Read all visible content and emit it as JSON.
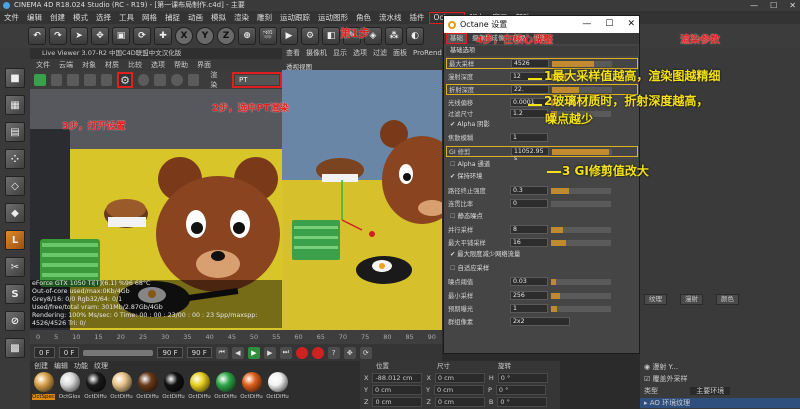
{
  "window": {
    "title": "CINEMA 4D R18.024 Studio (RC - R19) - [第一课布局制作.c4d] - 主要",
    "min": "—",
    "max": "☐",
    "close": "✕"
  },
  "menubar": [
    "文件",
    "编辑",
    "创建",
    "模式",
    "选择",
    "工具",
    "网格",
    "捕捉",
    "动画",
    "模拟",
    "渲染",
    "雕刻",
    "运动跟踪",
    "运动图形",
    "角色",
    "流水线",
    "插件",
    "Octane",
    "脚本",
    "窗口",
    "帮助"
  ],
  "toolbar": {
    "icons": [
      "arrow-icon",
      "move-icon",
      "scale-icon",
      "rotate-icon",
      "x-axis",
      "y-axis",
      "z-axis",
      "coord-icon",
      "film-icon",
      "render-icon",
      "render-settings-icon",
      "cube-icon",
      "pen-icon",
      "subdiv-icon",
      "array-icon",
      "deformer-icon",
      "floor-icon",
      "camera-icon",
      "light-icon"
    ],
    "xyz": [
      "X",
      "Y",
      "Z"
    ]
  },
  "live_viewer": {
    "title": "Live Viewer 3.07-R2 中国C4D联盟中文汉化版",
    "menu": [
      "文件",
      "云端",
      "对象",
      "材质",
      "比较",
      "选项",
      "帮助",
      "界面"
    ],
    "mode_label": "渲染",
    "mode_value": "PT"
  },
  "viewport": {
    "menu": [
      "查看",
      "摄像机",
      "显示",
      "选项",
      "过滤",
      "面板",
      "ProRender"
    ],
    "label": "透视视图"
  },
  "stats": [
    "eForce GTX 1050 Ti[T](6.1) %96      68°C",
    "Out-of-core used/max:0Kb/4Gb",
    "Grey8/16: 0/0        Rgb32/64: 0/1",
    "Used/free/total vram: 301Mb/2.87Gb/4Gb",
    "Rendering: 100%   Ms/sec: 0   Time: 00 : 00 : 23/00 : 00 : 23   Spp/maxspp: 4526/4526   Tri: 0/"
  ],
  "timeline": {
    "ticks": [
      "0",
      "5",
      "10",
      "15",
      "20",
      "25",
      "30",
      "35",
      "40",
      "45",
      "50",
      "55",
      "60",
      "65",
      "70",
      "75",
      "80",
      "85",
      "90"
    ],
    "start": "0 F",
    "end": "90 F",
    "current": "0 F",
    "max": "90 F"
  },
  "materials": {
    "menu": [
      "创建",
      "编辑",
      "功能",
      "纹理"
    ],
    "items": [
      {
        "label": "OctSpec",
        "color": "#d9a24a",
        "selected": true
      },
      {
        "label": "OctGlos",
        "color": "#d9d9d9",
        "selected": false
      },
      {
        "label": "OctDiffu",
        "color": "#1a1a1a",
        "selected": false
      },
      {
        "label": "OctDiffu",
        "color": "#e8c48a",
        "selected": false
      },
      {
        "label": "OctDiffu",
        "color": "#6a3a1a",
        "selected": false
      },
      {
        "label": "OctDiffu",
        "color": "#111111",
        "selected": false
      },
      {
        "label": "OctDiffu",
        "color": "#e8d020",
        "selected": false
      },
      {
        "label": "OctDiffu",
        "color": "#2fa84a",
        "selected": false
      },
      {
        "label": "OctDiffu",
        "color": "#e0601a",
        "selected": false
      },
      {
        "label": "OctDiffu",
        "color": "#f2f2f2",
        "selected": false
      }
    ]
  },
  "coords": {
    "headers": [
      "位置",
      "尺寸",
      "旋转"
    ],
    "rows": [
      {
        "axis": "X",
        "pos": "-88.012 cm",
        "size_axis": "X",
        "size": "0 cm",
        "rot_axis": "H",
        "rot": "0 °"
      },
      {
        "axis": "Y",
        "pos": "0 cm",
        "size_axis": "Y",
        "size": "0 cm",
        "rot_axis": "P",
        "rot": "0 °"
      },
      {
        "axis": "Z",
        "pos": "0 cm",
        "size_axis": "Z",
        "size": "0 cm",
        "rot_axis": "B",
        "rot": "0 °"
      }
    ]
  },
  "right_panel": {
    "btn1": "纹理",
    "btn2": "漫射",
    "btn3": "颜色",
    "row1": "◉ 漫射 Y...",
    "row2": "☑ 覆盖外采样",
    "row3": "类型",
    "row3_value": "主要环境",
    "row4": "▸ AO 环境纹理"
  },
  "dialog": {
    "title": "Octane 设置",
    "tabs": [
      "基础",
      "摄像机成像",
      "后期",
      "设置"
    ],
    "section_kernel": "基础选项",
    "params": [
      {
        "label": "最大采样",
        "value": "4526",
        "fill": 0.7,
        "highlight": true
      },
      {
        "label": "漫射深度",
        "value": "12",
        "fill": 0.25,
        "highlight": false
      },
      {
        "label": "折射深度",
        "value": "22.",
        "fill": 0.45,
        "highlight": true
      },
      {
        "label": "光线偏移",
        "value": "0.0001",
        "fill": 0.05,
        "highlight": false
      },
      {
        "label": "过滤尺寸",
        "value": "1.2",
        "fill": 0.1,
        "highlight": false
      }
    ],
    "alpha_shadows": "Alpha 阴影",
    "caustic_label": "焦散模糊",
    "caustic_value": "1",
    "gi_label": "GI 修剪",
    "gi_value": "11052.95 s",
    "alpha_channel": "Alpha 通道",
    "keep_env": "保持环境",
    "path_term_label": "路径终止强度",
    "path_term_value": "0.3",
    "coherent_label": "连贯比率",
    "coherent_value": "0",
    "static_noise": "静态噪点",
    "parallel_label": "并行采样",
    "parallel_value": "8",
    "max_tile_label": "最大平铺采样",
    "max_tile_value": "16",
    "min_net": "最大限度减少网络流量",
    "adaptive": "自适应采样",
    "noise_thr_label": "噪点阈值",
    "noise_thr_value": "0.03",
    "min_samples_label": "最小采样",
    "min_samples_value": "256",
    "expected_exp_label": "预期曝光",
    "expected_exp_value": "1",
    "group_label": "群组像素",
    "group_value": "2x2"
  },
  "annotations": {
    "step1": "第1步",
    "step2": "2步，选中PT渲染",
    "step3": "3步，打开设置",
    "step4": "4步，在核心调整",
    "step4b": "渲染参数",
    "note1": "1最大采样值越高，渲染图越精细",
    "note2a": "2玻璃材质时，折射深度越高，",
    "note2b": "噪点越少",
    "note3": "3  GI修剪值改大"
  },
  "colors": {
    "annotation_yellow": "#f4e214",
    "annotation_red": "#e02020",
    "octane_orange": "#e0a010"
  }
}
